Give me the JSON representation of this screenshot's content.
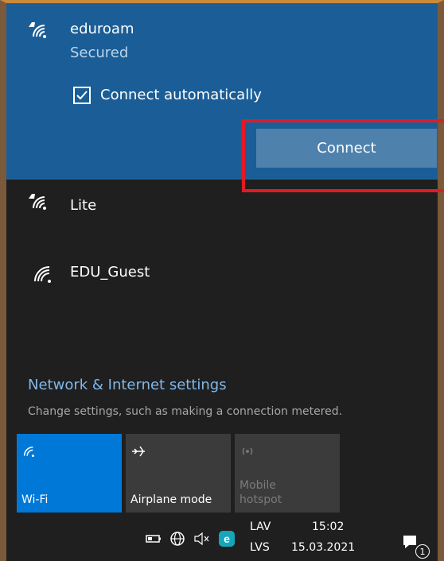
{
  "networks": [
    {
      "ssid": "eduroam",
      "status": "Secured",
      "icon": "wifi-lock-icon"
    },
    {
      "ssid": "Lite",
      "icon": "wifi-lock-icon"
    },
    {
      "ssid": "EDU_Guest",
      "icon": "wifi-icon"
    }
  ],
  "connect_automatically": {
    "label": "Connect automatically",
    "checked": true
  },
  "connect_button": "Connect",
  "settings": {
    "title": "Network & Internet settings",
    "subtitle": "Change settings, such as making a connection metered."
  },
  "quick_actions": [
    {
      "label": "Wi-Fi",
      "active": true
    },
    {
      "label": "Airplane mode",
      "active": false
    },
    {
      "label": "Mobile\nhotspot",
      "active": false,
      "disabled": true
    }
  ],
  "taskbar": {
    "lang_top": "LAV",
    "lang_bottom": "LVS",
    "time": "15:02",
    "date": "15.03.2021",
    "notification_count": "1"
  },
  "colors": {
    "accent": "#0078d7",
    "selected_bg": "#1b5e97",
    "highlight_box": "#e11b25"
  }
}
